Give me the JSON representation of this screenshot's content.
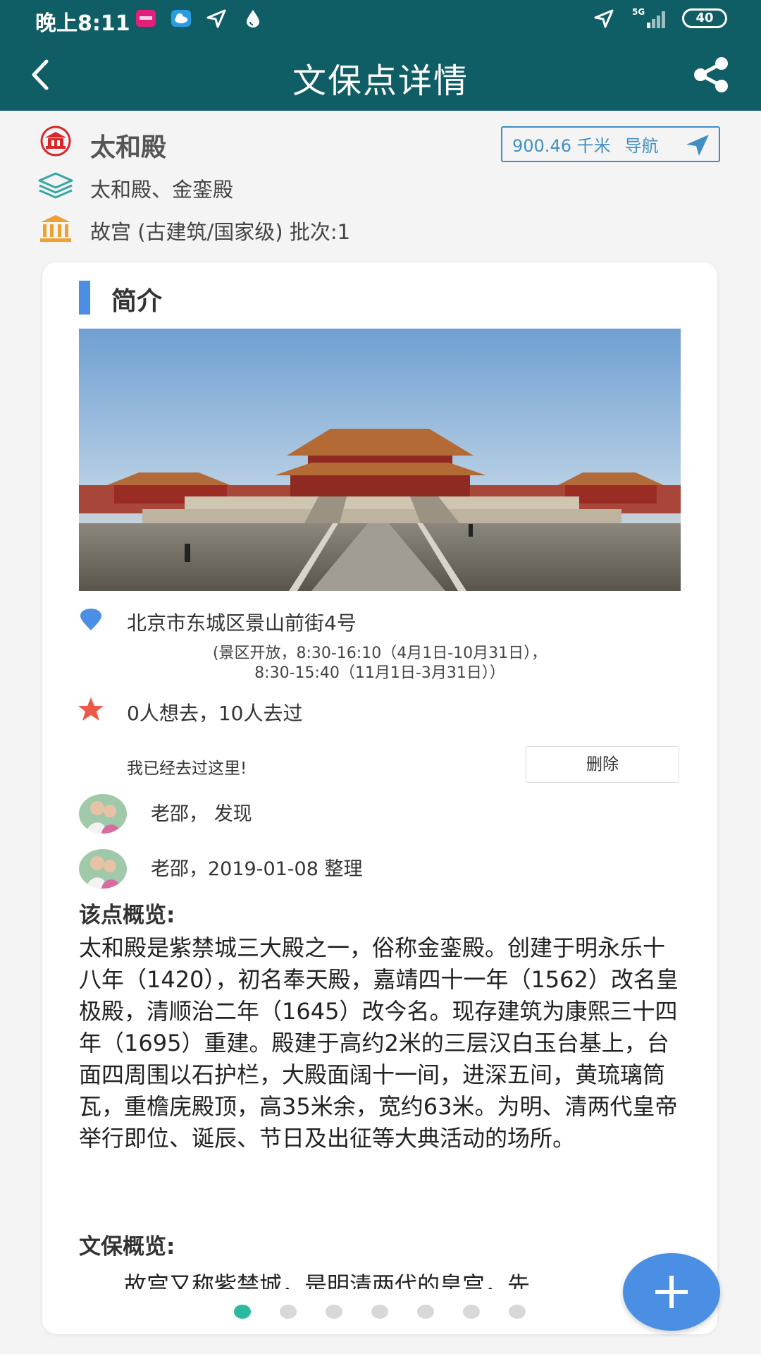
{
  "status_bar": {
    "time": "晚上8:11",
    "battery": "40",
    "network": "5G",
    "icons": [
      "app-badge-icon",
      "cloud-icon",
      "location-arrow-icon",
      "drop-icon",
      "location-arrow-icon",
      "signal-icon",
      "battery-icon"
    ]
  },
  "header": {
    "title": "文保点详情",
    "back_icon": "chevron-left-icon",
    "share_icon": "share-icon"
  },
  "site": {
    "name": "太和殿",
    "alias": "太和殿、金銮殿",
    "protection": "故宫 (古建筑/国家级) 批次:1",
    "distance": "900.46 千米",
    "nav_label": "导航"
  },
  "intro": {
    "section_title": "简介",
    "photo_icon": "palace-photo",
    "address": "北京市东城区景山前街4号",
    "hours_line1": "(景区开放，8:30-16:10（4月1日-10月31日），",
    "hours_line2": "8:30-15:40（11月1日-3月31日））",
    "visit_stats": "0人想去，10人去过",
    "visited_note": "我已经去过这里!",
    "delete_label": "删除"
  },
  "contributors": [
    {
      "text": "老邵，  发现"
    },
    {
      "text": "老邵，2019-01-08 整理"
    }
  ],
  "overview": {
    "heading": "该点概览:",
    "text": "太和殿是紫禁城三大殿之一，俗称金銮殿。创建于明永乐十八年（1420），初名奉天殿，嘉靖四十一年（1562）改名皇极殿，清顺治二年（1645）改今名。现存建筑为康熙三十四年（1695）重建。殿建于高约2米的三层汉白玉台基上，台面四周围以石护栏，大殿面阔十一间，进深五间，黄琉璃筒瓦，重檐庑殿顶，高35米余，宽约63米。为明、清两代皇帝举行即位、诞辰、节日及出征等大典活动的场所。"
  },
  "protection": {
    "heading": "文保概览:",
    "text": "故宫又称紫禁城，是明清两代的皇宫，先"
  },
  "pager": {
    "count": 7,
    "active": 0
  },
  "colors": {
    "header_bg": "#0f5d65",
    "accent_blue": "#4a8fe3",
    "nav_blue": "#3f8fc4",
    "active_dot": "#2bb9a0",
    "site_icon_red": "#d9262b",
    "layers_teal": "#3aa6a6",
    "museum_orange": "#f0a030",
    "star_red": "#ee5a4a"
  }
}
